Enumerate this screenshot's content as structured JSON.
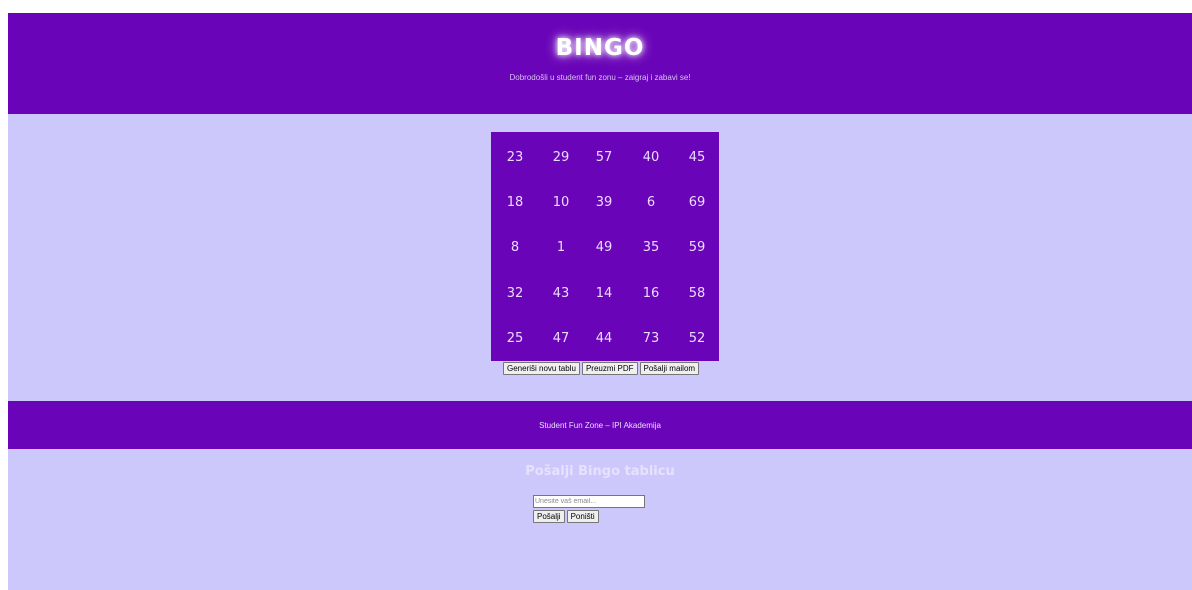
{
  "header": {
    "title": "BINGO",
    "subtitle": "Dobrodošli u student fun zonu – zaigraj i zabavi se!"
  },
  "board": {
    "rows": [
      [
        "23",
        "29",
        "57",
        "40",
        "45"
      ],
      [
        "18",
        "10",
        "39",
        "6",
        "69"
      ],
      [
        "8",
        "1",
        "49",
        "35",
        "59"
      ],
      [
        "32",
        "43",
        "14",
        "16",
        "58"
      ],
      [
        "25",
        "47",
        "44",
        "73",
        "52"
      ]
    ]
  },
  "actions": {
    "generate_label": "Generiši novu tablu",
    "pdf_label": "Preuzmi PDF",
    "mail_label": "Pošalji mailom"
  },
  "footer": {
    "text": "Student Fun Zone – IPI Akademija"
  },
  "send_form": {
    "heading": "Pošalji Bingo tablicu",
    "email_placeholder": "Unesite vaš email...",
    "send_label": "Pošalji",
    "reset_label": "Poništi"
  },
  "colors": {
    "primary": "#6a04b8",
    "background": "#ccc8fb",
    "board_text": "#ecdcff"
  }
}
